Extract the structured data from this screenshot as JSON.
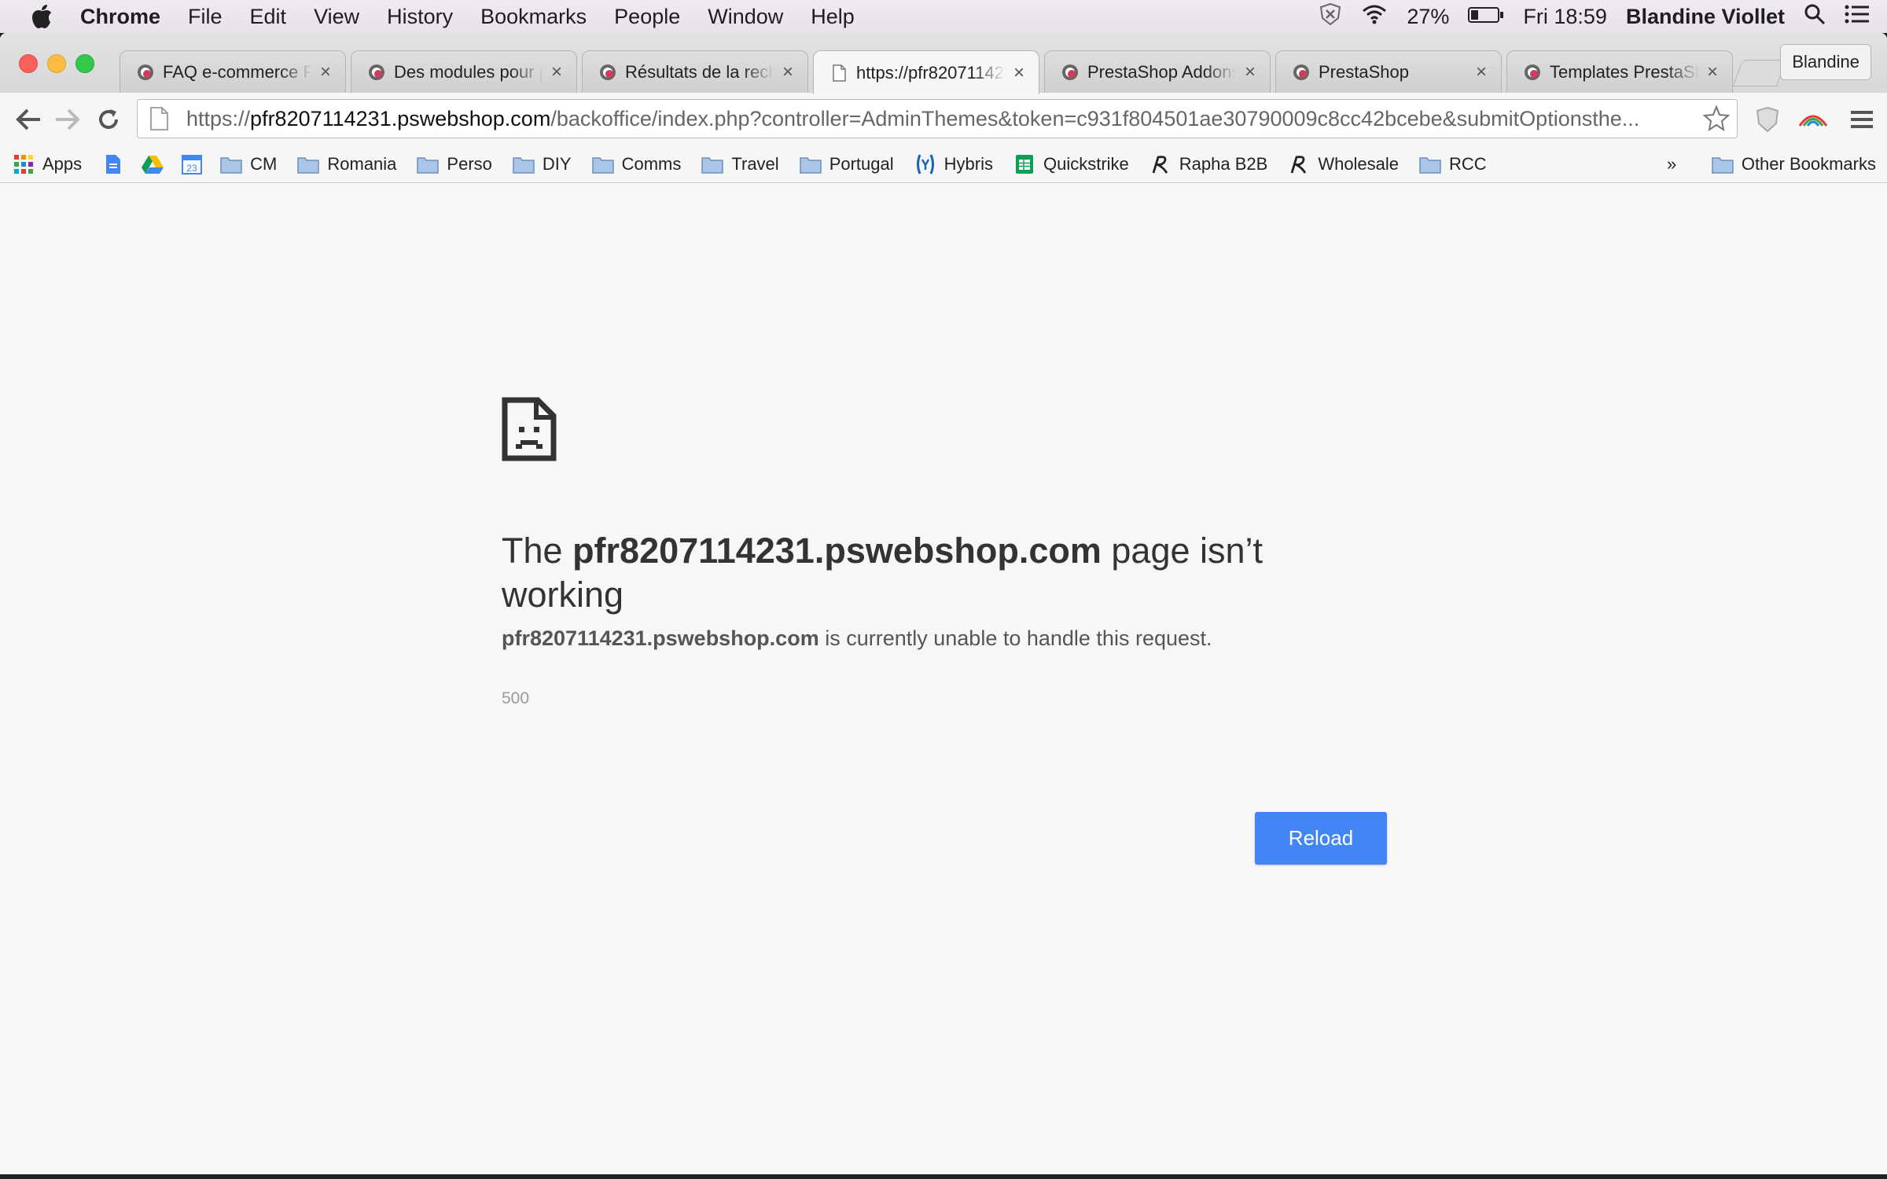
{
  "menubar": {
    "app_name": "Chrome",
    "menus": [
      "File",
      "Edit",
      "View",
      "History",
      "Bookmarks",
      "People",
      "Window",
      "Help"
    ],
    "battery": "27%",
    "clock": "Fri 18:59",
    "user": "Blandine Viollet"
  },
  "tabs": [
    {
      "title": "FAQ e-commerce P",
      "favicon": "prestashop-favicon"
    },
    {
      "title": "Des modules pour p",
      "favicon": "prestashop-favicon"
    },
    {
      "title": "Résultats de la rech",
      "favicon": "prestashop-favicon"
    },
    {
      "title": "https://pfr82071142",
      "favicon": "page-icon"
    },
    {
      "title": "PrestaShop Addons",
      "favicon": "prestashop-favicon"
    },
    {
      "title": "PrestaShop",
      "favicon": "prestashop-favicon"
    },
    {
      "title": "Templates PrestaSh",
      "favicon": "prestashop-favicon"
    }
  ],
  "profile_button": "Blandine",
  "omnibox": {
    "scheme": "https://",
    "host": "pfr8207114231.pswebshop.com",
    "path": "/backoffice/index.php?controller=AdminThemes&token=c931f804501ae30790009c8cc42bcebe&submitOptionsthe..."
  },
  "bookmarks": {
    "apps": "Apps",
    "calendar_day": "23",
    "items": [
      "CM",
      "Romania",
      "Perso",
      "DIY",
      "Comms",
      "Travel",
      "Portugal",
      "Hybris",
      "Quickstrike",
      "Rapha B2B",
      "Wholesale",
      "RCC"
    ],
    "overflow": "»",
    "other": "Other Bookmarks"
  },
  "error": {
    "title_prefix": "The",
    "title_host": "pfr8207114231.pswebshop.com",
    "title_suffix": "page isn’t working",
    "desc_host": "pfr8207114231.pswebshop.com",
    "desc_suffix": "is currently unable to handle this request.",
    "code": "500",
    "reload_label": "Reload",
    "button_color": "#4285f4"
  }
}
